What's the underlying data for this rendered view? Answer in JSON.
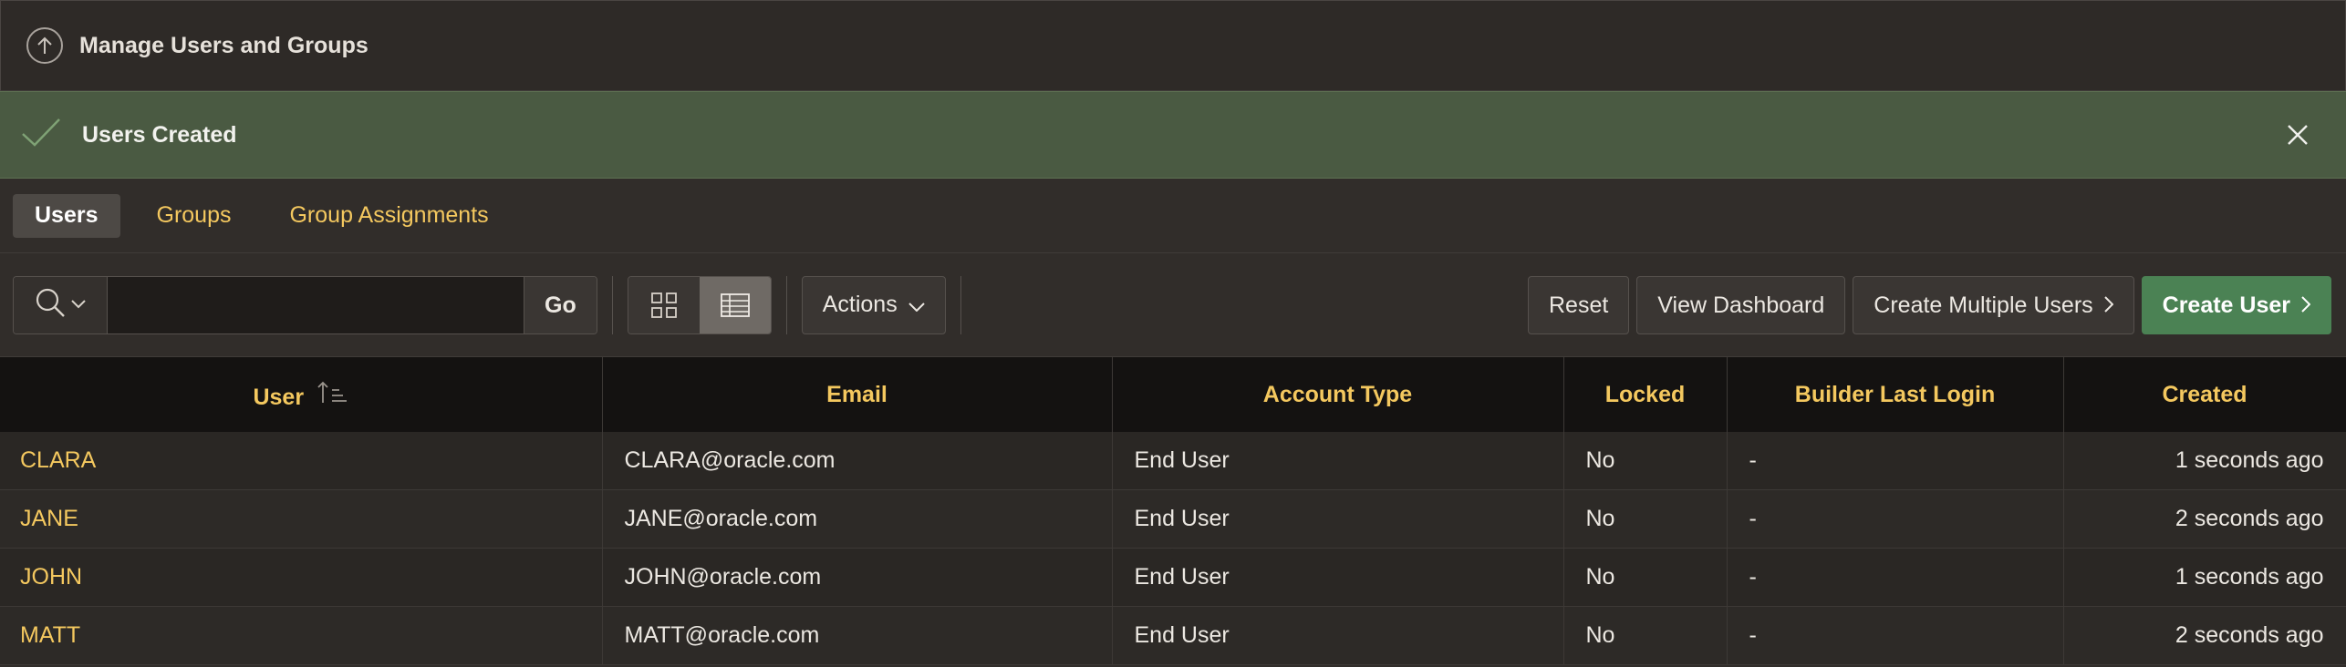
{
  "header": {
    "title": "Manage Users and Groups",
    "icon": "up-arrow-icon"
  },
  "alert": {
    "message": "Users Created",
    "color": "#4a5a42"
  },
  "tabs": [
    {
      "label": "Users",
      "active": true
    },
    {
      "label": "Groups",
      "active": false
    },
    {
      "label": "Group Assignments",
      "active": false
    }
  ],
  "toolbar": {
    "search_value": "",
    "go_label": "Go",
    "actions_label": "Actions",
    "reset_label": "Reset",
    "dashboard_label": "View Dashboard",
    "create_multiple_label": "Create Multiple Users",
    "create_user_label": "Create User"
  },
  "table": {
    "columns": [
      "User",
      "Email",
      "Account Type",
      "Locked",
      "Builder Last Login",
      "Created"
    ],
    "rows": [
      {
        "user": "CLARA",
        "email": "CLARA@oracle.com",
        "account_type": "End User",
        "locked": "No",
        "last_login": "-",
        "created": "1 seconds ago"
      },
      {
        "user": "JANE",
        "email": "JANE@oracle.com",
        "account_type": "End User",
        "locked": "No",
        "last_login": "-",
        "created": "2 seconds ago"
      },
      {
        "user": "JOHN",
        "email": "JOHN@oracle.com",
        "account_type": "End User",
        "locked": "No",
        "last_login": "-",
        "created": "1 seconds ago"
      },
      {
        "user": "MATT",
        "email": "MATT@oracle.com",
        "account_type": "End User",
        "locked": "No",
        "last_login": "-",
        "created": "2 seconds ago"
      }
    ]
  },
  "colors": {
    "accent": "#f4c85f",
    "primary": "#4b8254",
    "background": "#312d2a"
  }
}
